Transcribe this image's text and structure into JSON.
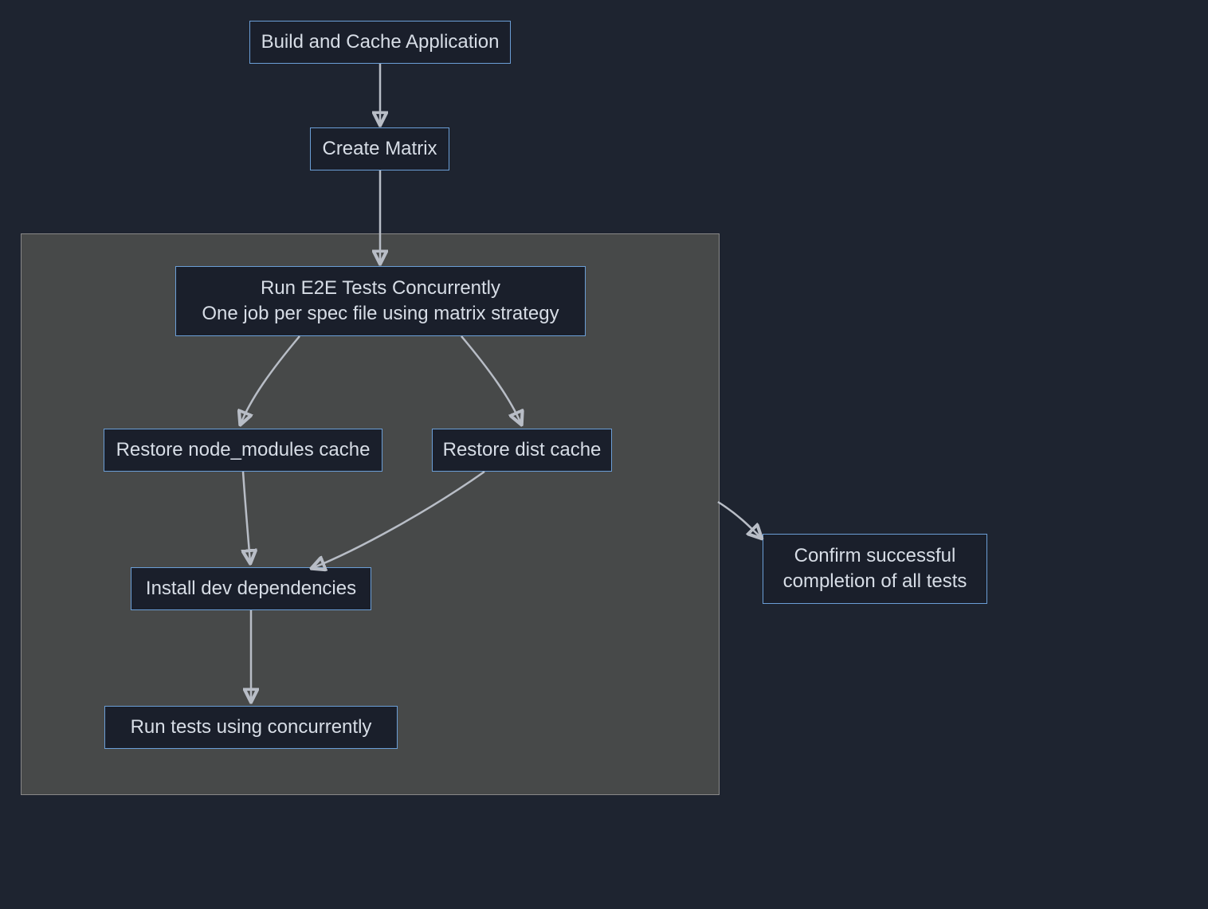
{
  "colors": {
    "bg": "#1e2430",
    "subgraph_bg": "#474949",
    "node_bg": "#1a1f2b",
    "node_border": "#6b9ed6",
    "edge": "#b8bdc6",
    "text": "#d7dde6"
  },
  "nodes": {
    "build_cache": {
      "label": "Build and Cache Application"
    },
    "create_matrix": {
      "label": "Create Matrix"
    },
    "run_e2e": {
      "line1": "Run E2E Tests Concurrently",
      "line2": "One job per spec file using matrix strategy"
    },
    "restore_node_modules": {
      "label": "Restore node_modules cache"
    },
    "restore_dist": {
      "label": "Restore dist cache"
    },
    "install_dev_deps": {
      "label": "Install dev dependencies"
    },
    "run_tests_concurrently": {
      "label": "Run tests using concurrently"
    },
    "confirm_success": {
      "line1": "Confirm successful",
      "line2": "completion of all tests"
    }
  },
  "edges": [
    {
      "from": "build_cache",
      "to": "create_matrix"
    },
    {
      "from": "create_matrix",
      "to": "run_e2e"
    },
    {
      "from": "run_e2e",
      "to": "restore_node_modules"
    },
    {
      "from": "run_e2e",
      "to": "restore_dist"
    },
    {
      "from": "restore_node_modules",
      "to": "install_dev_deps"
    },
    {
      "from": "restore_dist",
      "to": "install_dev_deps"
    },
    {
      "from": "install_dev_deps",
      "to": "run_tests_concurrently"
    },
    {
      "from": "subgraph",
      "to": "confirm_success"
    }
  ]
}
